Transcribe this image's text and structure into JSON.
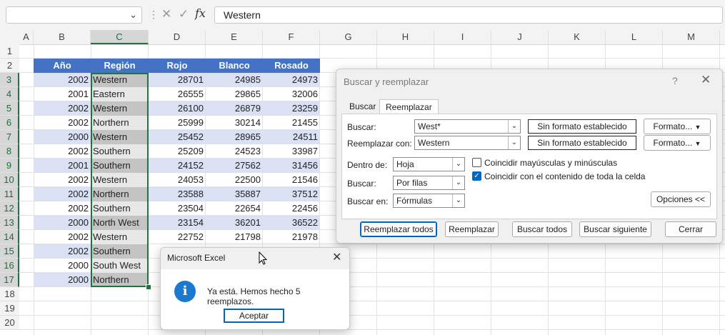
{
  "formula_bar": {
    "name_box": "",
    "fx": "fx",
    "value": "Western"
  },
  "columns": [
    "A",
    "B",
    "C",
    "D",
    "E",
    "F",
    "G",
    "H",
    "I",
    "J",
    "K",
    "L",
    "M"
  ],
  "rows": [
    "1",
    "2",
    "3",
    "4",
    "5",
    "6",
    "7",
    "8",
    "9",
    "10",
    "11",
    "12",
    "13",
    "14",
    "15",
    "16",
    "17",
    "18",
    "19",
    "20"
  ],
  "table": {
    "headers": [
      "Año",
      "Región",
      "Rojo",
      "Blanco",
      "Rosado"
    ],
    "rows": [
      [
        "2002",
        "Western",
        "28701",
        "24985",
        "24973"
      ],
      [
        "2001",
        "Eastern",
        "26555",
        "29865",
        "32006"
      ],
      [
        "2002",
        "Western",
        "26100",
        "26879",
        "23259"
      ],
      [
        "2002",
        "Northern",
        "25999",
        "30214",
        "21455"
      ],
      [
        "2000",
        "Western",
        "25452",
        "28965",
        "24511"
      ],
      [
        "2002",
        "Southern",
        "25209",
        "24523",
        "33987"
      ],
      [
        "2001",
        "Southern",
        "24152",
        "27562",
        "31456"
      ],
      [
        "2002",
        "Western",
        "24053",
        "22500",
        "21546"
      ],
      [
        "2002",
        "Northern",
        "23588",
        "35887",
        "37512"
      ],
      [
        "2002",
        "Southern",
        "23504",
        "22654",
        "22456"
      ],
      [
        "2000",
        "North West",
        "23154",
        "36201",
        "36522"
      ],
      [
        "2002",
        "Western",
        "22752",
        "21798",
        "21978"
      ],
      [
        "2002",
        "Southern",
        "",
        "",
        ""
      ],
      [
        "2000",
        "South West",
        "",
        "",
        ""
      ],
      [
        "2000",
        "Northern",
        "",
        "",
        ""
      ]
    ]
  },
  "find_replace": {
    "title": "Buscar y reemplazar",
    "help": "?",
    "tabs": [
      "Buscar",
      "Reemplazar"
    ],
    "find_label": "Buscar:",
    "find_value": "West*",
    "replace_label": "Reemplazar con:",
    "replace_value": "Western",
    "no_format": "Sin formato establecido",
    "format_btn": "Formato...",
    "within_label": "Dentro de:",
    "within_value": "Hoja",
    "search_label": "Buscar:",
    "search_value": "Por filas",
    "lookin_label": "Buscar en:",
    "lookin_value": "Fórmulas",
    "match_case": "Coincidir mayúsculas y minúsculas",
    "match_case_checked": false,
    "match_entire": "Coincidir con el contenido de toda la celda",
    "match_entire_checked": true,
    "options_btn": "Opciones <<",
    "replace_all": "Reemplazar todos",
    "replace": "Reemplazar",
    "find_all": "Buscar todos",
    "find_next": "Buscar siguiente",
    "close": "Cerrar"
  },
  "message_box": {
    "title": "Microsoft Excel",
    "text": "Ya está. Hemos hecho 5 reemplazos.",
    "ok": "Aceptar",
    "icon": "info-icon"
  }
}
